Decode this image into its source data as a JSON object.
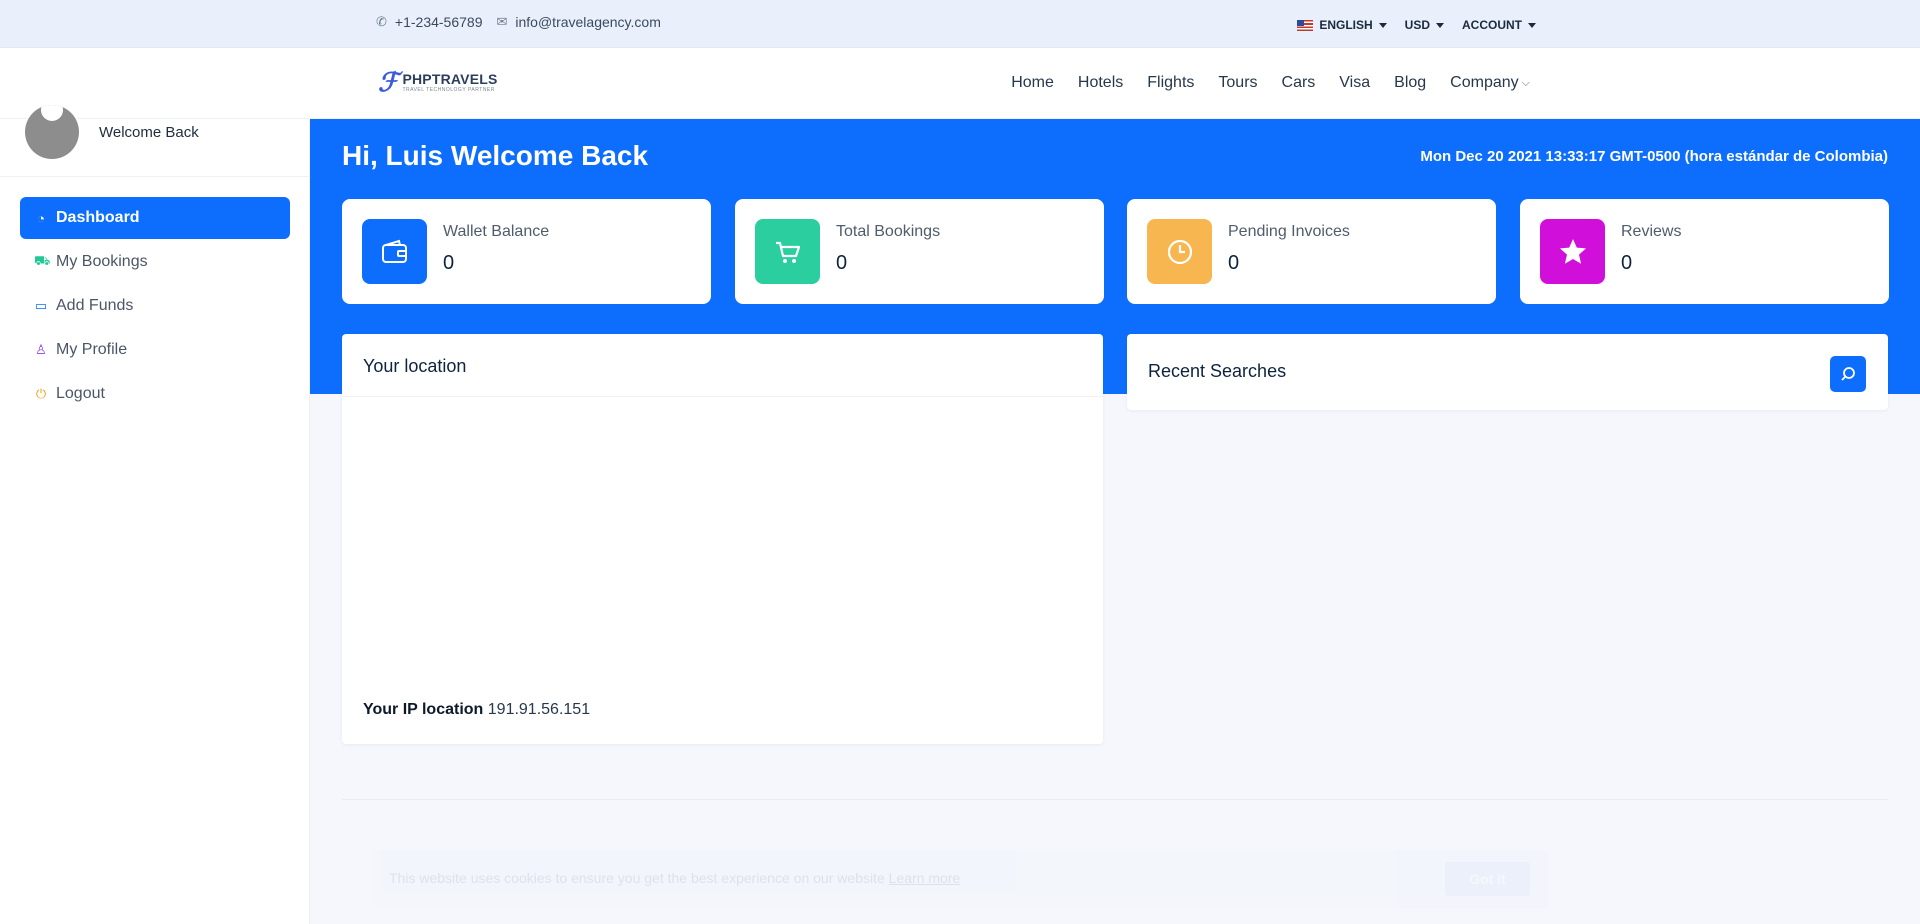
{
  "topbar": {
    "phone": "+1-234-56789",
    "email": "info@travelagency.com",
    "language": "ENGLISH",
    "currency": "USD",
    "account": "ACCOUNT"
  },
  "header": {
    "brand": "PHPTRAVELS",
    "tagline": "TRAVEL TECHNOLOGY PARTNER",
    "nav": [
      "Home",
      "Hotels",
      "Flights",
      "Tours",
      "Cars",
      "Visa",
      "Blog",
      "Company"
    ]
  },
  "sidebar": {
    "welcome": "Welcome Back",
    "items": [
      {
        "label": "Dashboard",
        "icon": "dashboard-icon",
        "color": "#ffffff"
      },
      {
        "label": "My Bookings",
        "icon": "cart-icon",
        "color": "#20c997"
      },
      {
        "label": "Add Funds",
        "icon": "wallet-icon",
        "color": "#0d6efd"
      },
      {
        "label": "My Profile",
        "icon": "user-icon",
        "color": "#8f3ee8"
      },
      {
        "label": "Logout",
        "icon": "power-icon",
        "color": "#f39c12"
      }
    ]
  },
  "main": {
    "greeting": "Hi, Luis Welcome Back",
    "datetime": "Mon Dec 20 2021 13:33:17 GMT-0500 (hora estándar de Colombia)",
    "stats": [
      {
        "label": "Wallet Balance",
        "value": "0",
        "icon": "wallet-icon",
        "color": "#0d6efd"
      },
      {
        "label": "Total Bookings",
        "value": "0",
        "icon": "cart-icon",
        "color": "#2bcf9f"
      },
      {
        "label": "Pending Invoices",
        "value": "0",
        "icon": "clock-icon",
        "color": "#f7b64f"
      },
      {
        "label": "Reviews",
        "value": "0",
        "icon": "star-icon",
        "color": "#d10fdb"
      }
    ],
    "location": {
      "title": "Your location",
      "ip_label": "Your IP location",
      "ip_value": "191.91.56.151"
    },
    "recent": {
      "title": "Recent Searches"
    }
  },
  "cookie": {
    "message": "This website uses cookies to ensure you get the best experience on our website",
    "link": "Learn more",
    "button": "Got it"
  }
}
